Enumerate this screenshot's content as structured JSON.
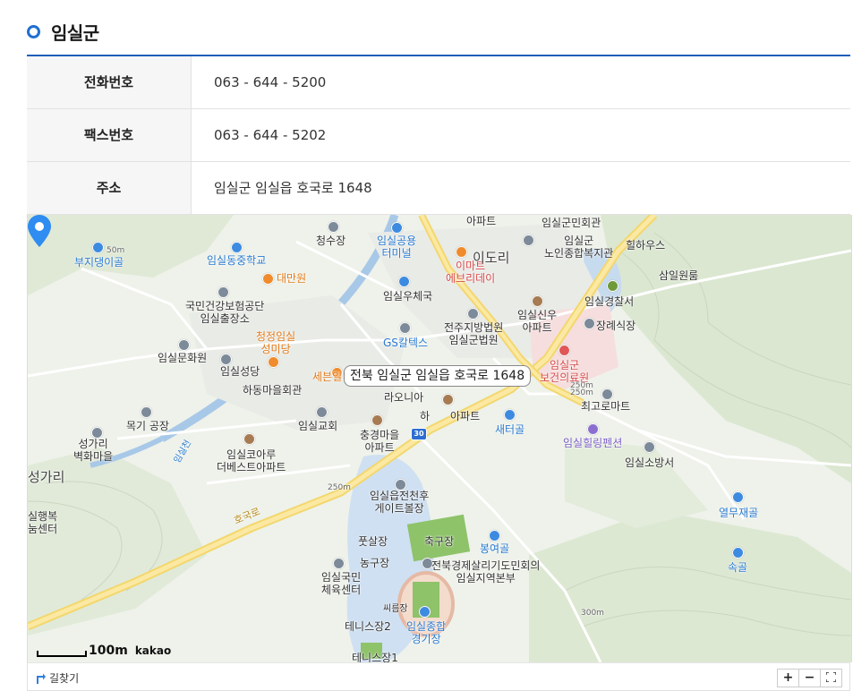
{
  "section": {
    "title": "임실군"
  },
  "info": [
    {
      "label": "전화번호",
      "value": "063 - 644 - 5200"
    },
    {
      "label": "팩스번호",
      "value": "063 - 644 - 5202"
    },
    {
      "label": "주소",
      "value": "임실군 임실읍 호국로 1648"
    }
  ],
  "map": {
    "callout": "전북 임실군 임실읍 호국로 1648",
    "route_number": "30",
    "scale_text": "100m",
    "provider": "kakao",
    "labels": {
      "apartment_top": "아파트",
      "imsil_gunmin_hall": "임실군민회관",
      "imsil_senior_center": "임실군\n노인종합복지관",
      "hilhouse": "힐하우스",
      "samil_wonroom": "삼일원룸",
      "bujidaengi": "부지댕이골",
      "cheongsu": "청수장",
      "imsil_bus_terminal": "임실공용\n터미널",
      "emart": "이마트\n에브리데이",
      "idori": "이도리",
      "imsil_dong_middle": "임실동중학교",
      "daemanwon": "대만원",
      "imsil_post": "임실우체국",
      "imsil_police": "임실경찰서",
      "nhis": "국민건강보험공단\n임실출장소",
      "jeonju_court": "전주지방법원\n임실군법원",
      "imsil_sinu_apt": "임실신우\n아파트",
      "jangrye": "장례식장",
      "cheongjeong": "청정임실\n성미당",
      "gs_caltex": "GS칼텍스",
      "imsil_health": "임실군\n보건의료원",
      "imsil_culture": "임실문화원",
      "imsil_cathedral": "임실성당",
      "semart": "세븐일",
      "elev_250_a": "250m",
      "hadong_hall": "하동마을회관",
      "raonia": "라오니아",
      "choigo_mart": "최고로마트",
      "mokgi": "목기 공장",
      "ha_apt": "하",
      "apt_partial": "아파트",
      "imsil_church": "임실교회",
      "chunggyeong_apt": "충경마을\n아파트",
      "saetergol": "새터골",
      "imsil_healing": "임실힐링펜션",
      "imsil_fire": "임실소방서",
      "seonggari_village": "성가리\n벽화마을",
      "imsil_koaru": "임실코아루\n더베스트아파트",
      "stream": "임실천",
      "seonggari": "성가리",
      "elev_250_b": "250m",
      "gate_ball": "임실읍전천후\n게이트볼장",
      "yeolmujae": "열무재골",
      "welfare_center": "실행복\n눔센터",
      "hoguk_road": "호국로",
      "futsal": "풋살장",
      "soccer": "축구장",
      "bongyeo": "봉여골",
      "nonggu": "농구장",
      "sokgol": "속골",
      "jeonbuk_council": "전북경제살리기도민회의\n임실지역본부",
      "imsil_gym": "임실국민\n체육센터",
      "ssireum": "씨름장",
      "tennis2": "테니스장2",
      "imsil_stadium": "임실종합\n경기장",
      "elev_300": "300m",
      "tennis1": "테니스장1",
      "elev_50": "50m",
      "elev_250_c": "250m"
    }
  },
  "footer": {
    "directions": "길찾기",
    "zoom_in": "+",
    "zoom_out": "−",
    "fullscreen_icon": "fullscreen-icon"
  }
}
